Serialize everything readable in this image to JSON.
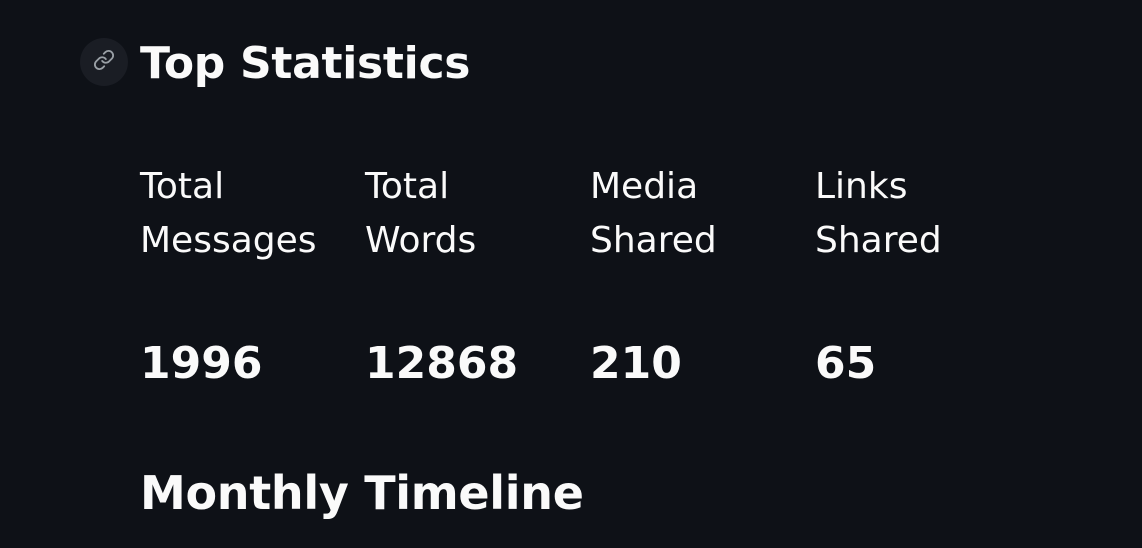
{
  "sections": {
    "top_statistics": {
      "title": "Top Statistics",
      "anchor_icon": "link-icon"
    },
    "monthly_timeline": {
      "title": "Monthly Timeline"
    }
  },
  "stats": [
    {
      "label": "Total\nMessages",
      "value": "1996"
    },
    {
      "label": "Total\nWords",
      "value": "12868"
    },
    {
      "label": "Media\nShared",
      "value": "210"
    },
    {
      "label": "Links\nShared",
      "value": "65"
    }
  ],
  "colors": {
    "background": "#0e1117",
    "text": "#fafafa",
    "anchor_bg": "#1a1d24"
  }
}
